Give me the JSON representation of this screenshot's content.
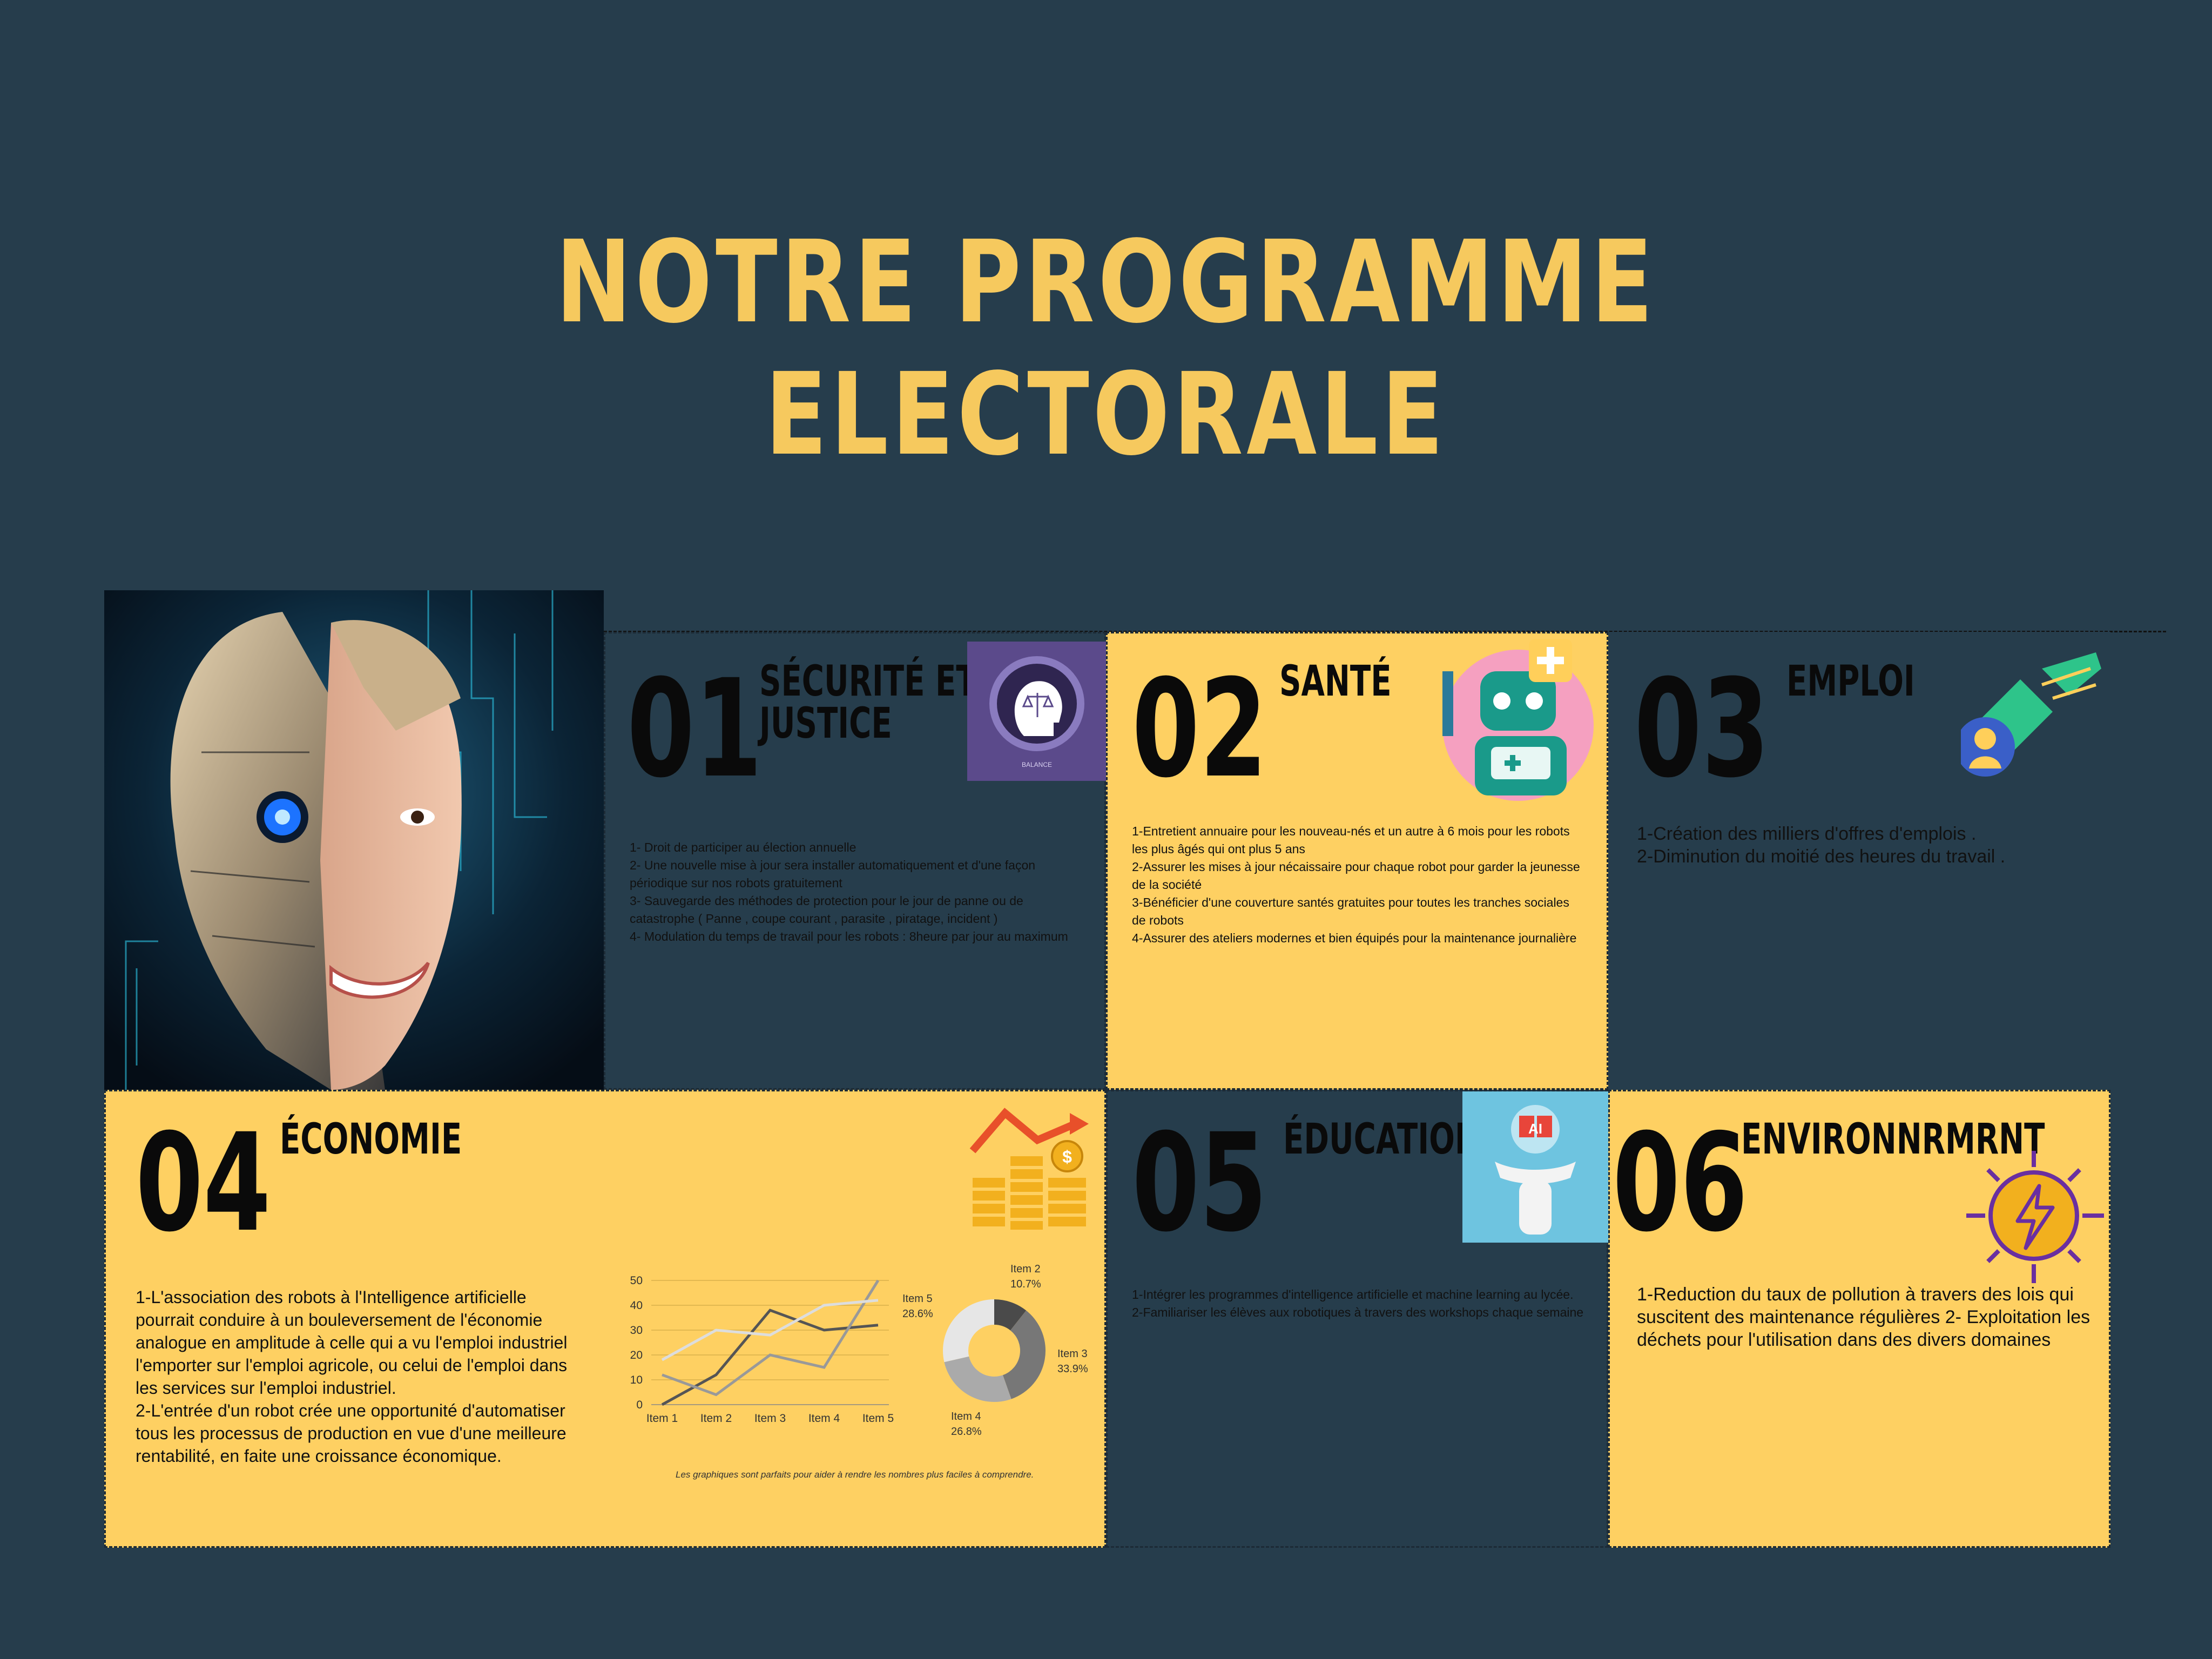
{
  "title": "NOTRE PROGRAMME ELECTORALE",
  "sections": [
    {
      "num": "01",
      "heading": "SÉCURITÉ  ET\nJUSTICE",
      "icon_label": "BALANCE",
      "body": "1- Droit de participer au élection annuelle\n 2- Une nouvelle mise à jour sera installer automatiquement et d'une façon périodique sur nos robots gratuitement\n 3- Sauvegarde des méthodes de protection pour le jour de panne ou de catastrophe ( Panne , coupe courant , parasite , piratage, incident )\n4- Modulation du temps de travail pour les robots : 8heure par jour au maximum"
    },
    {
      "num": "02",
      "heading": "SANTÉ",
      "body": "1-Entretient annuaire pour les nouveau-nés et un autre à 6 mois pour les robots les plus âgés qui ont plus 5 ans\n2-Assurer les mises à jour nécaissaire pour chaque robot pour garder la jeunesse de la société\n3-Bénéficier d'une couverture santés gratuites pour toutes les tranches sociales de robots\n4-Assurer des ateliers modernes et bien équipés pour la maintenance journalière"
    },
    {
      "num": "03",
      "heading": "EMPLOI",
      "body": "1-Création des milliers d'offres d'emplois .\n2-Diminution du moitié des heures du travail ."
    },
    {
      "num": "04",
      "heading": "ÉCONOMIE",
      "body": "1-L'association des robots à l'Intelligence artificielle pourrait conduire à un bouleversement de l'économie analogue en amplitude à celle qui a vu l'emploi industriel l'emporter sur l'emploi agricole, ou celui de l'emploi dans les services sur l'emploi industriel.\n2-L'entrée d'un robot crée une opportunité d'automatiser tous les processus de production en vue d'une meilleure rentabilité, en faite une croissance économique."
    },
    {
      "num": "05",
      "heading": "ÉDUCATION",
      "body": "1-Intégrer les programmes d'intelligence artificielle et machine learning au lycée.\n2-Familiariser les élèves aux robotiques à travers des workshops chaque semaine"
    },
    {
      "num": "06",
      "heading": "ENVIRONNRMRNT",
      "body": "1-Reduction du taux de pollution à travers des lois qui suscitent des maintenance régulières 2- Exploitation les déchets pour l'utilisation dans des divers domaines"
    }
  ],
  "chart_caption": "Les graphiques sont parfaits pour aider à rendre les nombres plus faciles à comprendre.",
  "colors": {
    "background": "#263d4c",
    "accent": "#f6c95e",
    "card_yellow": "#fed062"
  },
  "chart_data": [
    {
      "type": "line",
      "categories": [
        "Item 1",
        "Item 2",
        "Item 3",
        "Item 4",
        "Item 5"
      ],
      "ylim": [
        0,
        50
      ],
      "yticks": [
        0,
        10,
        20,
        30,
        40,
        50
      ],
      "series": [
        {
          "values": [
            0,
            12,
            38,
            30,
            32
          ],
          "color": "#555555"
        },
        {
          "values": [
            12,
            4,
            20,
            15,
            50
          ],
          "color": "#999999"
        },
        {
          "values": [
            18,
            30,
            28,
            40,
            42
          ],
          "color": "#dddddd"
        }
      ]
    },
    {
      "type": "pie",
      "slices": [
        {
          "name": "Item 2",
          "value": 10.7,
          "label": "10.7%",
          "color": "#4a4a4a"
        },
        {
          "name": "Item 3",
          "value": 33.9,
          "label": "33.9%",
          "color": "#777777"
        },
        {
          "name": "Item 4",
          "value": 26.8,
          "label": "26.8%",
          "color": "#aaaaaa"
        },
        {
          "name": "Item 5",
          "value": 28.6,
          "label": "28.6%",
          "color": "#e6e6e6"
        }
      ]
    }
  ]
}
